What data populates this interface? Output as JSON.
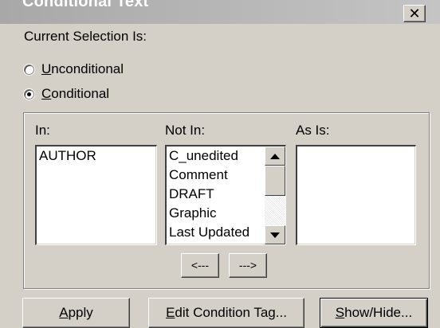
{
  "window": {
    "title": "Conditional Text",
    "close_glyph": "✕"
  },
  "selection": {
    "label": "Current Selection Is:",
    "options": [
      {
        "mnemonic": "U",
        "rest": "nconditional",
        "selected": false
      },
      {
        "mnemonic": "C",
        "rest": "onditional",
        "selected": true
      }
    ]
  },
  "columns": {
    "in_label": "In:",
    "not_in_label": "Not In:",
    "as_is_label": "As Is:"
  },
  "lists": {
    "in_items": [
      "AUTHOR"
    ],
    "not_in_items": [
      "C_unedited",
      "Comment",
      "DRAFT",
      "Graphic",
      "Last Updated"
    ],
    "as_is_items": []
  },
  "move_buttons": {
    "left_label": "<---",
    "right_label": "--->"
  },
  "buttons": {
    "apply_mnemonic": "A",
    "apply_rest": "pply",
    "edit_mnemonic": "E",
    "edit_rest": "dit Condition Tag...",
    "show_mnemonic": "S",
    "show_rest": "how/Hide..."
  },
  "colors": {
    "dialog_bg": "#d4d0c8",
    "title_bar": "#b0b0b0"
  }
}
